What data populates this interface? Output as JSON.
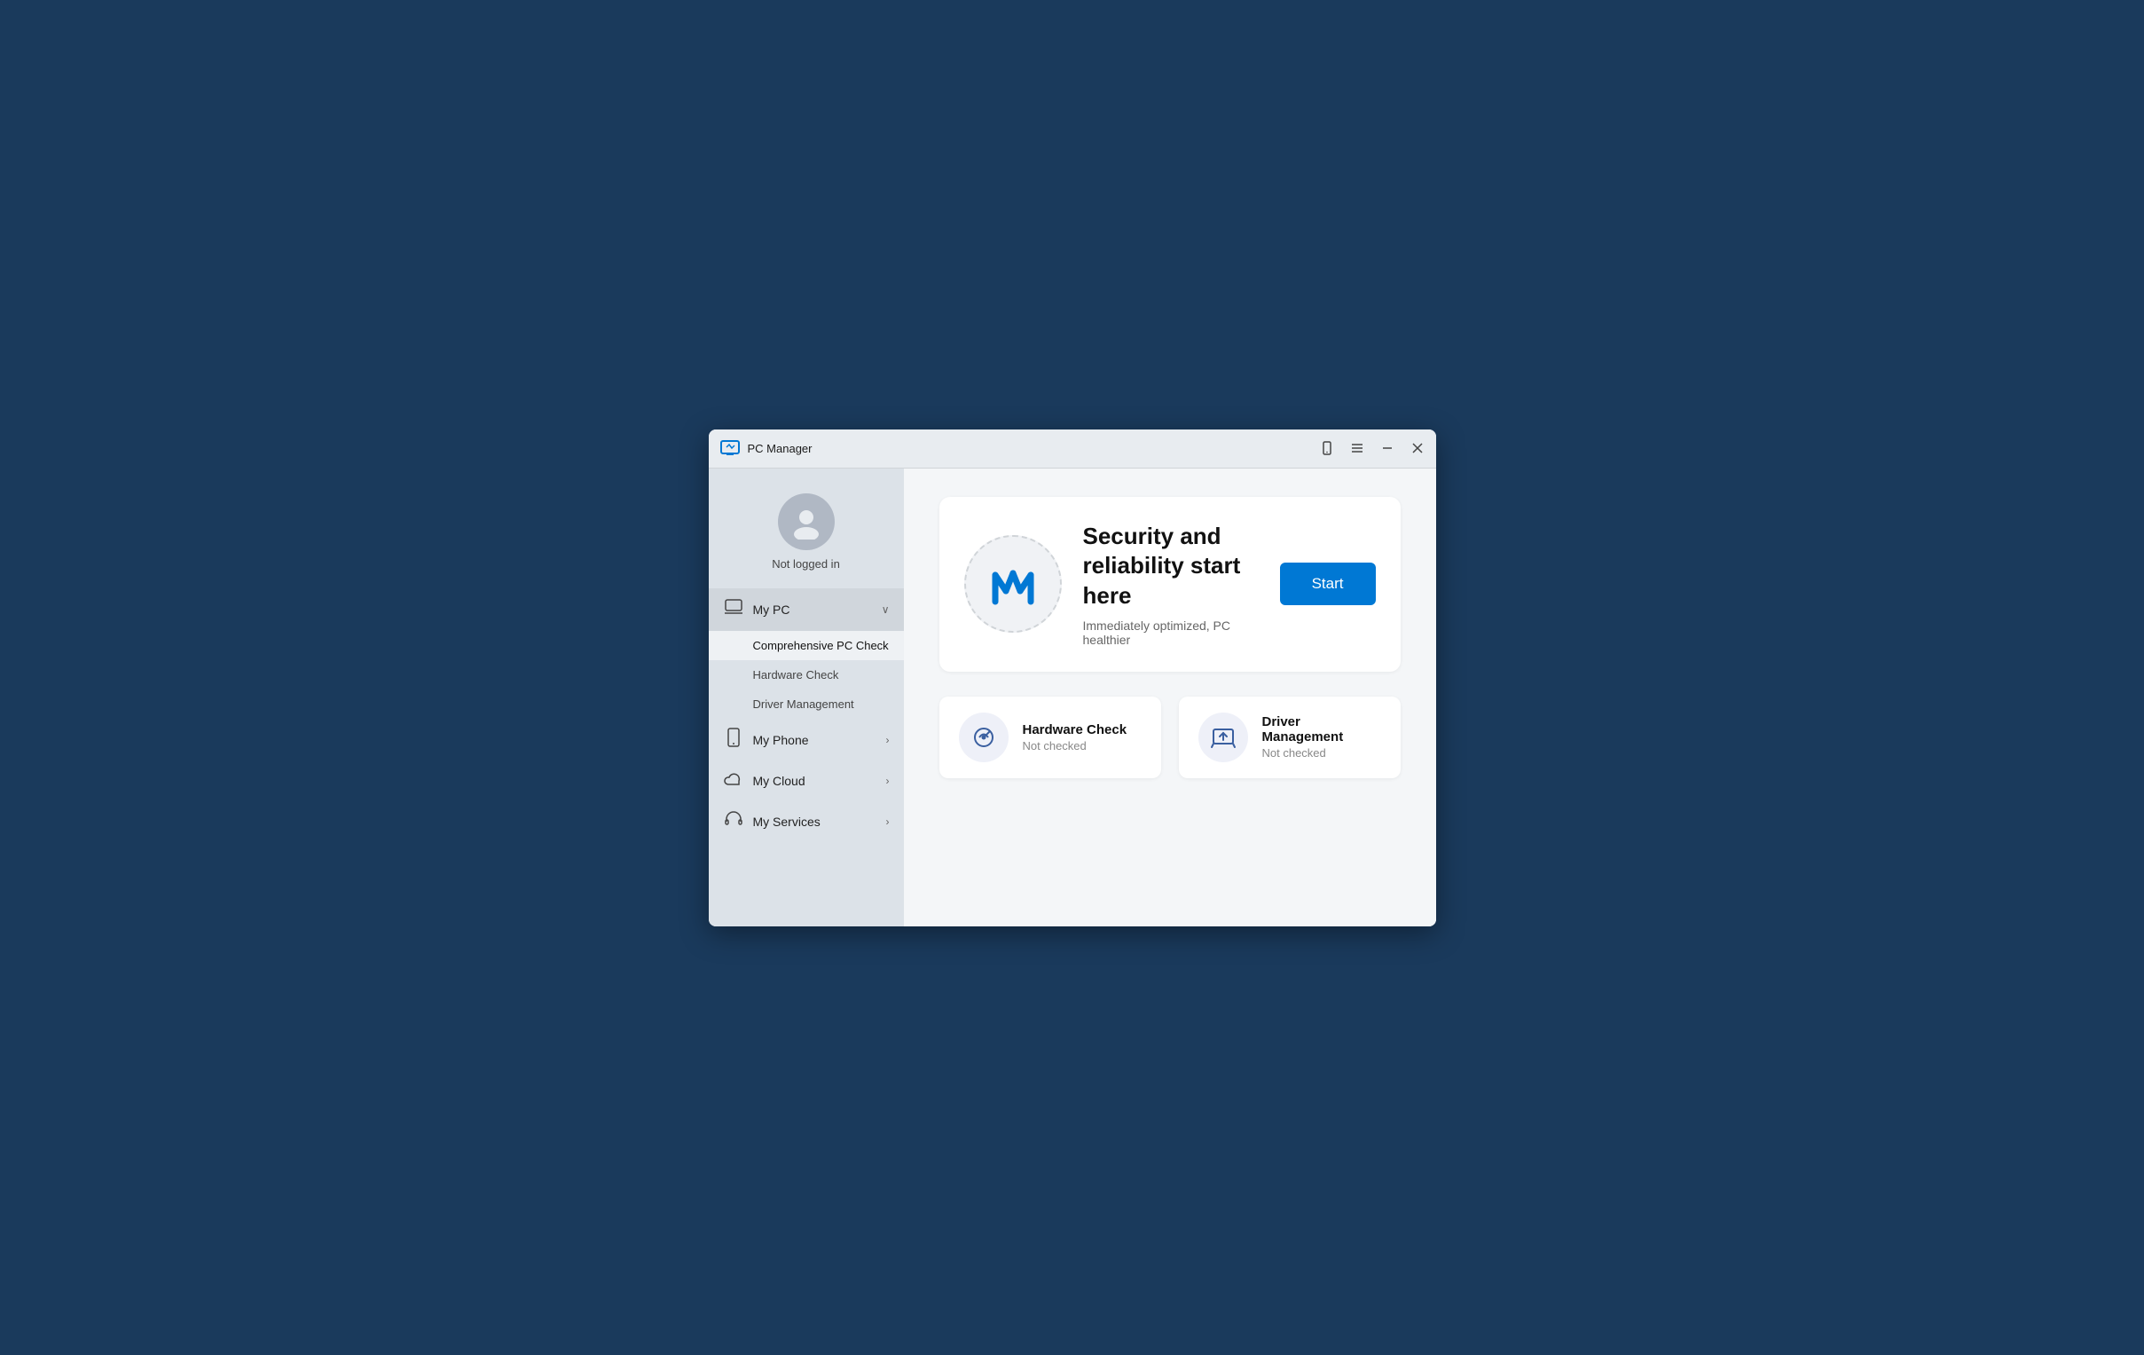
{
  "titleBar": {
    "title": "PC Manager",
    "controls": {
      "phone_label": "📱",
      "menu_label": "☰",
      "minimize_label": "—",
      "close_label": "✕"
    }
  },
  "sidebar": {
    "user": {
      "label": "Not logged in"
    },
    "nav": [
      {
        "id": "my-pc",
        "icon": "🖥",
        "label": "My PC",
        "expanded": true,
        "chevron": "∨",
        "subItems": [
          {
            "id": "comprehensive-pc-check",
            "label": "Comprehensive PC Check",
            "active": true
          },
          {
            "id": "hardware-check",
            "label": "Hardware Check"
          },
          {
            "id": "driver-management",
            "label": "Driver Management"
          }
        ]
      },
      {
        "id": "my-phone",
        "icon": "📱",
        "label": "My Phone",
        "chevron": "›"
      },
      {
        "id": "my-cloud",
        "icon": "☁",
        "label": "My Cloud",
        "chevron": "›"
      },
      {
        "id": "my-services",
        "icon": "🎧",
        "label": "My Services",
        "chevron": "›"
      }
    ]
  },
  "content": {
    "hero": {
      "title": "Security and reliability start here",
      "subtitle": "Immediately optimized, PC healthier",
      "startButton": "Start"
    },
    "cards": [
      {
        "id": "hardware-check",
        "title": "Hardware Check",
        "status": "Not checked"
      },
      {
        "id": "driver-management",
        "title": "Driver Management",
        "status": "Not checked"
      }
    ]
  }
}
